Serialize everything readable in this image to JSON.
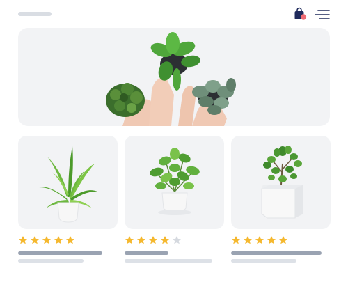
{
  "header": {
    "logo_text": "",
    "cart_icon": "shopping-bag-icon",
    "cart_badge_color": "#ef6b73",
    "menu_icon": "hamburger-menu-icon"
  },
  "hero": {
    "image": "hands-holding-potted-plants"
  },
  "products": [
    {
      "image": "dracaena-plant-in-white-pot",
      "rating": 5,
      "max_rating": 5
    },
    {
      "image": "pilea-plant-in-white-pot-with-saucer",
      "rating": 4,
      "max_rating": 5
    },
    {
      "image": "jade-plant-in-white-cube-planter",
      "rating": 5,
      "max_rating": 5
    }
  ],
  "colors": {
    "star_filled": "#f5b82e",
    "star_empty": "#d5d9df",
    "card_background": "#f2f3f5",
    "text_placeholder_dark": "#9aa3b2",
    "text_placeholder_light": "#dde1e7"
  }
}
